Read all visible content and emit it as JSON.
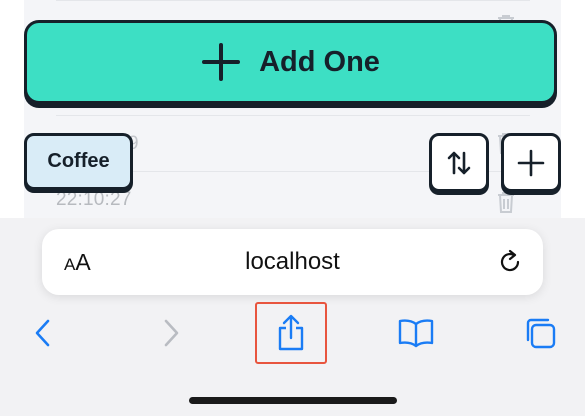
{
  "app": {
    "add_button_label": "Add One",
    "chip_label": "Coffee",
    "partial_row_text": "9",
    "row_time": "22:10:27",
    "sort_icon": "sort-arrows-icon",
    "add_icon": "plus-icon"
  },
  "browser": {
    "text_size_label_small": "A",
    "text_size_label_big": "A",
    "url": "localhost",
    "reload_icon": "reload-icon",
    "toolbar": [
      "back-icon",
      "forward-icon",
      "share-icon",
      "bookmarks-icon",
      "tabs-icon"
    ],
    "highlighted_item": "share"
  },
  "colors": {
    "accent": "#3ddfc4",
    "ink": "#16202a",
    "chip": "#d9ecf7",
    "ios_blue": "#1a7cf5",
    "highlight": "#e8553e"
  }
}
